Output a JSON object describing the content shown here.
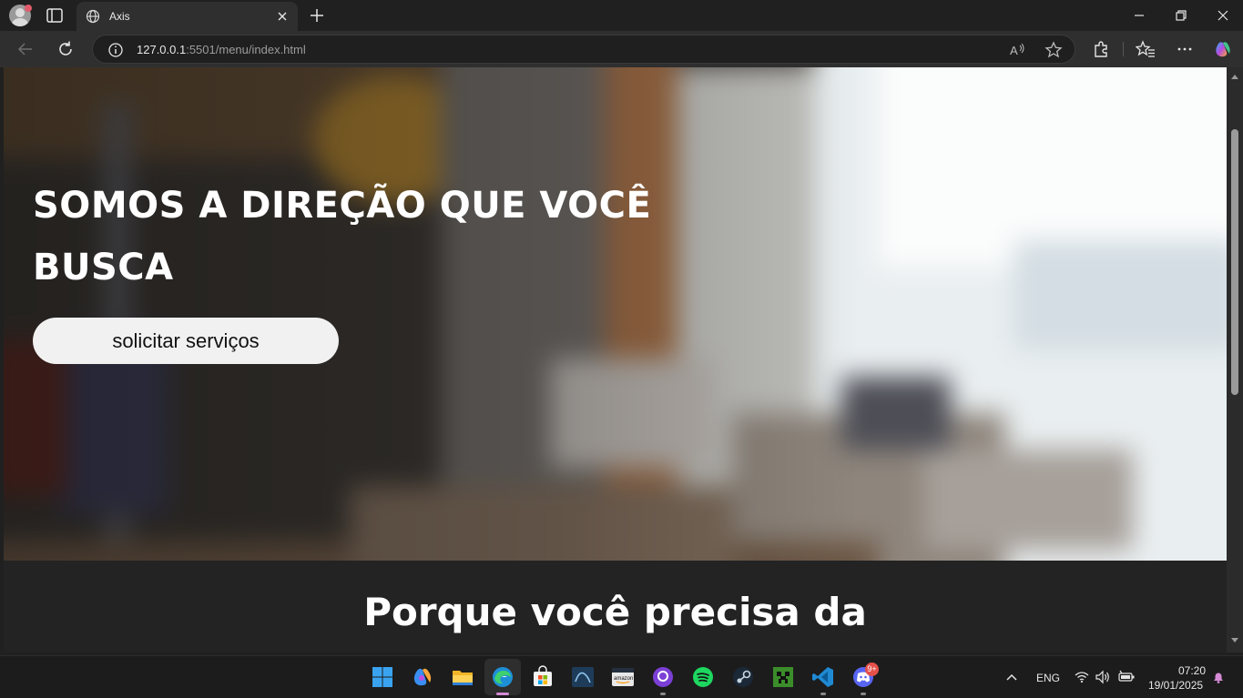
{
  "browser": {
    "tab_title": "Axis",
    "url_host": "127.0.0.1",
    "url_rest": ":5501/menu/index.html"
  },
  "page": {
    "hero_title_line1": "SOMOS A DIREÇÃO QUE VOCÊ",
    "hero_title_line2": "BUSCA",
    "cta_label": "solicitar serviços",
    "section_title": "Porque você precisa da"
  },
  "taskbar": {
    "language": "ENG",
    "time": "07:20",
    "date": "19/01/2025",
    "discord_badge": "9+",
    "apps": [
      "start-icon",
      "copilot-icon",
      "file-explorer-icon",
      "edge-icon",
      "store-icon",
      "mysql-workbench-icon",
      "amazon-icon",
      "github-desktop-icon",
      "spotify-icon",
      "steam-icon",
      "minecraft-icon",
      "vscode-icon",
      "discord-icon"
    ]
  },
  "colors": {
    "chrome_dark": "#202020",
    "toolbar": "#2f2f2f",
    "page_dark": "#232323",
    "button_bg": "#f1f1f1"
  }
}
